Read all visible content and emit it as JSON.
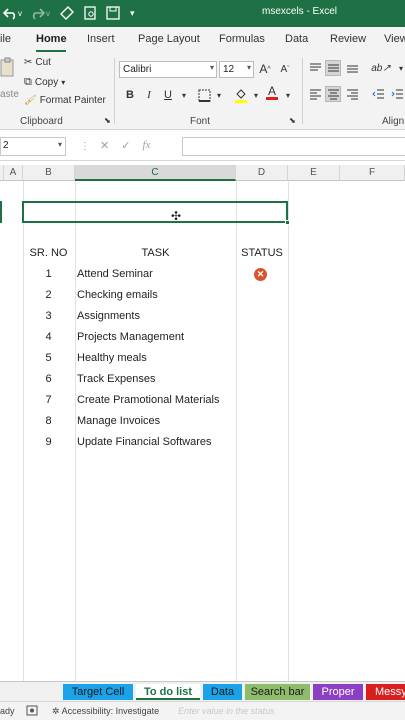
{
  "window": {
    "title": "msexcels - Excel"
  },
  "ribbon_tabs": [
    "ile",
    "Home",
    "Insert",
    "Page Layout",
    "Formulas",
    "Data",
    "Review",
    "View"
  ],
  "clipboard": {
    "paste_label": "aste",
    "cut": "Cut",
    "copy": "Copy",
    "format_painter": "Format Painter",
    "group_label": "Clipboard"
  },
  "font": {
    "name": "Calibri",
    "size": "12",
    "bold": "B",
    "italic": "I",
    "underline": "U",
    "font_color_glyph": "A",
    "grow": "A",
    "shrink": "A",
    "group_label": "Font"
  },
  "alignment": {
    "group_label": "Align"
  },
  "formula_bar": {
    "name_box": "2",
    "cancel_icon": "✕",
    "enter_icon": "✓",
    "fx": "fx",
    "value": ""
  },
  "columns": [
    "A",
    "B",
    "C",
    "D",
    "E",
    "F"
  ],
  "table": {
    "headers": {
      "no": "SR. NO",
      "task": "TASK",
      "status": "STATUS"
    },
    "rows": [
      {
        "no": "1",
        "task": "Attend Seminar",
        "status_icon": "x-circle-icon"
      },
      {
        "no": "2",
        "task": "Checking emails"
      },
      {
        "no": "3",
        "task": "Assignments"
      },
      {
        "no": "4",
        "task": "Projects Management"
      },
      {
        "no": "5",
        "task": "Healthy meals"
      },
      {
        "no": "6",
        "task": "Track Expenses"
      },
      {
        "no": "7",
        "task": "Create Pramotional Materials"
      },
      {
        "no": "8",
        "task": "Manage Invoices"
      },
      {
        "no": "9",
        "task": "Update Financial Softwares"
      }
    ]
  },
  "sheet_tabs": [
    {
      "label": "Target Cell",
      "color": "#1aa3e8"
    },
    {
      "label": "To do list",
      "color": "#ffffff",
      "active": true
    },
    {
      "label": "Data",
      "color": "#1aa3e8"
    },
    {
      "label": "Search bar",
      "color": "#8fbc6a"
    },
    {
      "label": "Proper",
      "color": "#8c3fc2"
    },
    {
      "label": "Messy",
      "color": "#d91e1e"
    }
  ],
  "status_bar": {
    "ready": "ady",
    "accessibility": "Accessibility: Investigate",
    "hint": "Enter value in the status"
  },
  "colors": {
    "excel_green": "#1e7145",
    "status_x": "#d9542e"
  }
}
